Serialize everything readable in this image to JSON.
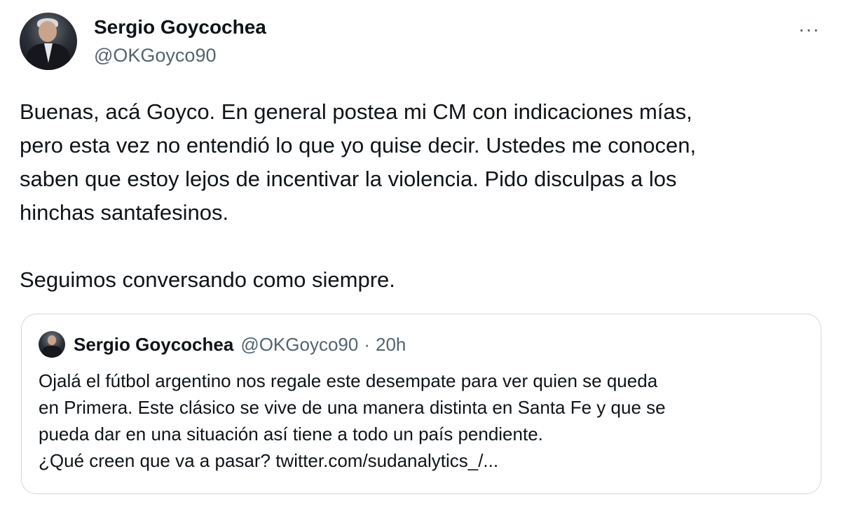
{
  "tweet": {
    "author": {
      "display_name": "Sergio Goycochea",
      "handle": "@OKGoyco90",
      "avatar_icon": "profile-photo"
    },
    "more_label": "···",
    "text": "Buenas, acá Goyco. En general postea mi CM con indicaciones mías,\npero esta vez no entendió lo que yo quise decir. Ustedes me conocen,\nsaben que estoy lejos de incentivar la violencia. Pido disculpas a los\nhinchas santafesinos.\n\nSeguimos conversando como siempre."
  },
  "quoted_tweet": {
    "display_name": "Sergio Goycochea",
    "handle": "@OKGoyco90",
    "separator": "·",
    "time": "20h",
    "text": "Ojalá el fútbol argentino nos regale este desempate para ver quien se queda\nen Primera. Este clásico se vive de una manera distinta en Santa Fe y que se\npueda dar en una situación así tiene a todo un país pendiente.\n¿Qué creen que va a pasar? twitter.com/sudanalytics_/..."
  },
  "colors": {
    "text_primary": "#0f1419",
    "text_secondary": "#536471",
    "border": "#cfd9de",
    "background": "#ffffff"
  }
}
